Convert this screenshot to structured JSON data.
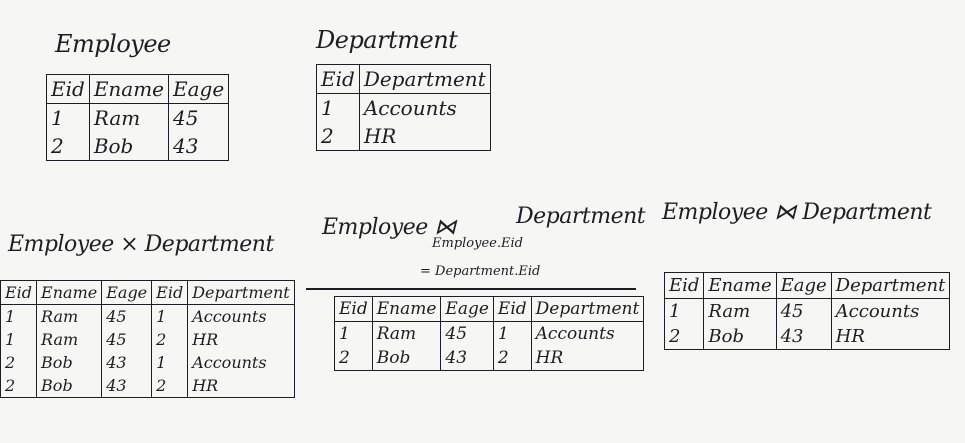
{
  "employee": {
    "title": "Employee",
    "headers": [
      "Eid",
      "Ename",
      "Eage"
    ],
    "rows": [
      [
        "1",
        "Ram",
        "45"
      ],
      [
        "2",
        "Bob",
        "43"
      ]
    ]
  },
  "department": {
    "title": "Department",
    "headers": [
      "Eid",
      "Department"
    ],
    "rows": [
      [
        "1",
        "Accounts"
      ],
      [
        "2",
        "HR"
      ]
    ]
  },
  "cross": {
    "title": "Employee × Department",
    "headers": [
      "Eid",
      "Ename",
      "Eage",
      "Eid",
      "Department"
    ],
    "rows": [
      [
        "1",
        "Ram",
        "45",
        "1",
        "Accounts"
      ],
      [
        "1",
        "Ram",
        "45",
        "2",
        "HR"
      ],
      [
        "2",
        "Bob",
        "43",
        "1",
        "Accounts"
      ],
      [
        "2",
        "Bob",
        "43",
        "2",
        "HR"
      ]
    ]
  },
  "theta": {
    "title_left": "Employee ⋈",
    "title_right": "Department",
    "condition_line1": "Employee.Eid",
    "condition_line2": "= Department.Eid",
    "headers": [
      "Eid",
      "Ename",
      "Eage",
      "Eid",
      "Department"
    ],
    "rows": [
      [
        "1",
        "Ram",
        "45",
        "1",
        "Accounts"
      ],
      [
        "2",
        "Bob",
        "43",
        "2",
        "HR"
      ]
    ]
  },
  "natural": {
    "title": "Employee ⋈ Department",
    "headers": [
      "Eid",
      "Ename",
      "Eage",
      "Department"
    ],
    "rows": [
      [
        "1",
        "Ram",
        "45",
        "Accounts"
      ],
      [
        "2",
        "Bob",
        "43",
        "HR"
      ]
    ]
  }
}
